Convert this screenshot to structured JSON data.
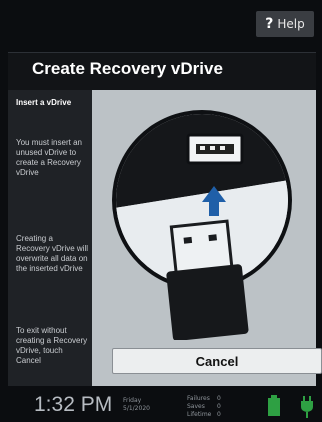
{
  "header": {
    "help_label": "Help",
    "help_glyph": "?"
  },
  "dialog": {
    "title": "Create Recovery vDrive",
    "sidebar": {
      "heading": "Insert a vDrive",
      "paragraph1": "You must insert an unused vDrive to create a Recovery vDrive",
      "paragraph2": "Creating a Recovery vDrive will overwrite all data on the inserted vDrive",
      "paragraph3": "To exit without creating a Recovery vDrive, touch Cancel"
    },
    "illustration": {
      "icon": "usb-insert-icon"
    },
    "cancel_label": "Cancel"
  },
  "status": {
    "time": "1:32 PM",
    "day": "Friday",
    "date": "5/1/2020",
    "stats": [
      {
        "label": "Failures",
        "value": "0"
      },
      {
        "label": "Saves",
        "value": "0"
      },
      {
        "label": "Lifetime",
        "value": "0"
      }
    ],
    "battery_icon": "battery-full-icon",
    "power_icon": "ac-plug-icon"
  },
  "colors": {
    "accent_green": "#2ea043",
    "arrow_blue": "#1f5fa8",
    "panel_gray": "#bcc2c6"
  }
}
